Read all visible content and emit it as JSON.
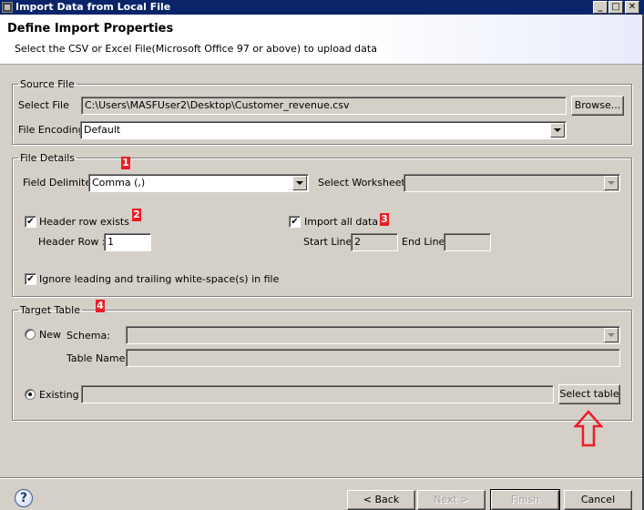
{
  "window": {
    "title": "Import Data from Local File",
    "controls": {
      "minimize": "_",
      "maximize": "□",
      "close": "✕"
    }
  },
  "header": {
    "title": "Define Import Properties",
    "description": "Select the CSV or Excel File(Microsoft Office 97 or above) to upload data"
  },
  "source_file": {
    "legend": "Source File",
    "select_file_label": "Select File",
    "select_file_value": "C:\\Users\\MASFUser2\\Desktop\\Customer_revenue.csv",
    "browse_label": "Browse...",
    "encoding_label": "File Encoding",
    "encoding_value": "Default"
  },
  "file_details": {
    "legend": "File Details",
    "delimiter_label": "Field Delimiter",
    "delimiter_value": "Comma (,)",
    "worksheet_label": "Select Worksheet:",
    "worksheet_value": "",
    "header_row_exists_label": "Header row exists",
    "header_row_exists_checked": true,
    "header_row_label": "Header Row :",
    "header_row_value": "1",
    "import_all_label": "Import all data",
    "import_all_checked": true,
    "start_line_label": "Start Line",
    "start_line_value": "2",
    "end_line_label": "End Line",
    "end_line_value": "",
    "ignore_ws_label": "Ignore leading and trailing white-space(s) in file",
    "ignore_ws_checked": true
  },
  "target_table": {
    "legend": "Target Table",
    "new_label": "New",
    "new_selected": false,
    "schema_label": "Schema:",
    "schema_value": "",
    "table_name_label": "Table Name:",
    "table_name_value": "",
    "existing_label": "Existing",
    "existing_selected": true,
    "existing_value": "",
    "select_table_label": "Select table"
  },
  "annotations": {
    "badges": [
      "1",
      "2",
      "3",
      "4"
    ],
    "arrow_color": "#ed1c24"
  },
  "footer": {
    "help_glyph": "?",
    "back_label": "< Back",
    "next_label": "Next >",
    "finish_label": "Finish",
    "cancel_label": "Cancel"
  },
  "check_glyph": "✔",
  "colors": {
    "titlebar": "#0a246a",
    "dialog_bg": "#d4d0c8",
    "badge": "#ed1c24"
  }
}
